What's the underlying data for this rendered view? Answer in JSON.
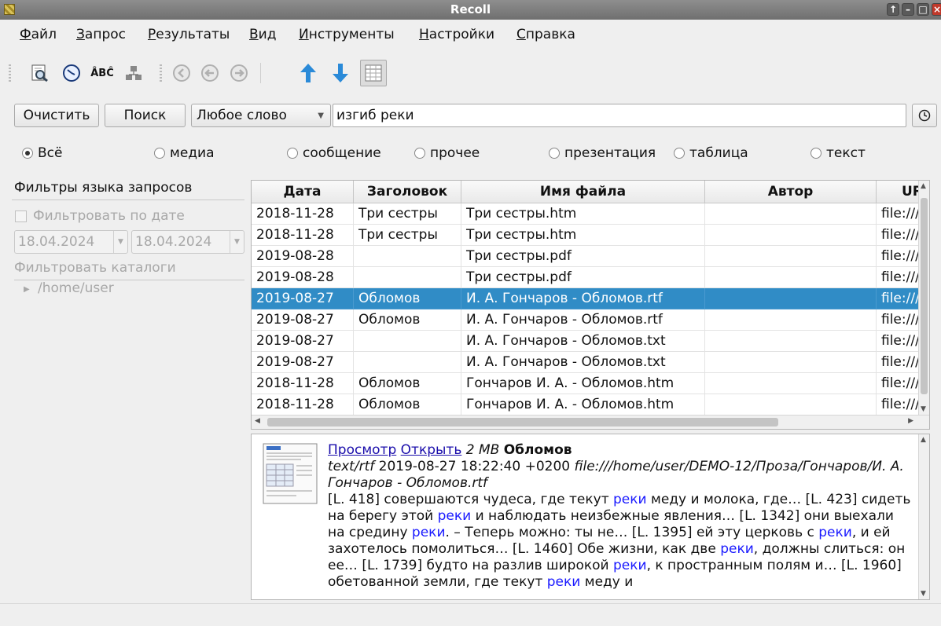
{
  "window": {
    "title": "Recoll"
  },
  "menu": [
    "Файл",
    "Запрос",
    "Результаты",
    "Вид",
    "Инструменты",
    "Настройки",
    "Справка"
  ],
  "toolbar": {
    "icons": [
      "query-tool-icon",
      "history-icon",
      "spelling-icon",
      "index-icon",
      "back-icon",
      "prev-icon",
      "next-icon",
      "sort-up-icon",
      "sort-down-icon",
      "table-view-icon"
    ]
  },
  "search": {
    "clear_label": "Очистить",
    "search_label": "Поиск",
    "mode": "Любое слово",
    "query": "изгиб реки"
  },
  "filters": {
    "categories": [
      "Всё",
      "медиа",
      "сообщение",
      "прочее",
      "презентация",
      "таблица",
      "текст"
    ],
    "selected": "Всё"
  },
  "left_panel": {
    "header": "Фильтры языка запросов",
    "date_filter_label": "Фильтровать по дате",
    "date_from": "18.04.2024",
    "date_to": "18.04.2024",
    "dir_filter_label": "Фильтровать каталоги",
    "dir": "/home/user"
  },
  "table": {
    "columns": [
      "Дата",
      "Заголовок",
      "Имя файла",
      "Автор",
      "URL"
    ],
    "rows": [
      {
        "date": "2018-11-28",
        "title": "Три сестры",
        "file": "Три сестры.htm",
        "author": "",
        "url": "file:///h"
      },
      {
        "date": "2018-11-28",
        "title": "Три сестры",
        "file": "Три сестры.htm",
        "author": "",
        "url": "file:///h"
      },
      {
        "date": "2019-08-28",
        "title": "",
        "file": "Три сестры.pdf",
        "author": "",
        "url": "file:///h"
      },
      {
        "date": "2019-08-28",
        "title": "",
        "file": "Три сестры.pdf",
        "author": "",
        "url": "file:///h"
      },
      {
        "date": "2019-08-27",
        "title": "Обломов",
        "file": "И. А. Гончаров - Обломов.rtf",
        "author": "",
        "url": "file:///h"
      },
      {
        "date": "2019-08-27",
        "title": "Обломов",
        "file": "И. А. Гончаров - Обломов.rtf",
        "author": "",
        "url": "file:///h"
      },
      {
        "date": "2019-08-27",
        "title": "",
        "file": "И. А. Гончаров - Обломов.txt",
        "author": "",
        "url": "file:///h"
      },
      {
        "date": "2019-08-27",
        "title": "",
        "file": "И. А. Гончаров - Обломов.txt",
        "author": "",
        "url": "file:///h"
      },
      {
        "date": "2018-11-28",
        "title": "Обломов",
        "file": "Гончаров И. А. - Обломов.htm",
        "author": "",
        "url": "file:///h"
      },
      {
        "date": "2018-11-28",
        "title": "Обломов",
        "file": "Гончаров И. А. - Обломов.htm",
        "author": "",
        "url": "file:///h"
      }
    ],
    "selected_row": 4
  },
  "preview": {
    "preview_link": "Просмотр",
    "open_link": "Открыть",
    "size": "2 MB",
    "title": "Обломов",
    "mime": "text/rtf",
    "datetime": "2019-08-27 18:22:40 +0200",
    "path": "file:///home/user/DEMO-12/Проза/Гончаров/И. А. Гончаров - Обломов.rtf",
    "snippet": [
      {
        "t": "[L. 418] совершаются чудеса, где текут "
      },
      {
        "t": "реки",
        "h": true
      },
      {
        "t": " меду и молока, где… [L. 423] сидеть на берегу этой "
      },
      {
        "t": "реки",
        "h": true
      },
      {
        "t": " и наблюдать неизбежные явления… [L. 1342] они выехали на средину "
      },
      {
        "t": "реки",
        "h": true
      },
      {
        "t": ". – Теперь можно: ты не… [L. 1395] ей эту церковь с "
      },
      {
        "t": "реки",
        "h": true
      },
      {
        "t": ", и ей захотелось помолиться… [L. 1460] Обе жизни, как две "
      },
      {
        "t": "реки",
        "h": true
      },
      {
        "t": ", должны слиться: он ее… [L. 1739] будто на разлив широкой "
      },
      {
        "t": "реки",
        "h": true
      },
      {
        "t": ", к пространным полям и… [L. 1960] обетованной земли, где текут "
      },
      {
        "t": "реки",
        "h": true
      },
      {
        "t": " меду и"
      }
    ]
  }
}
